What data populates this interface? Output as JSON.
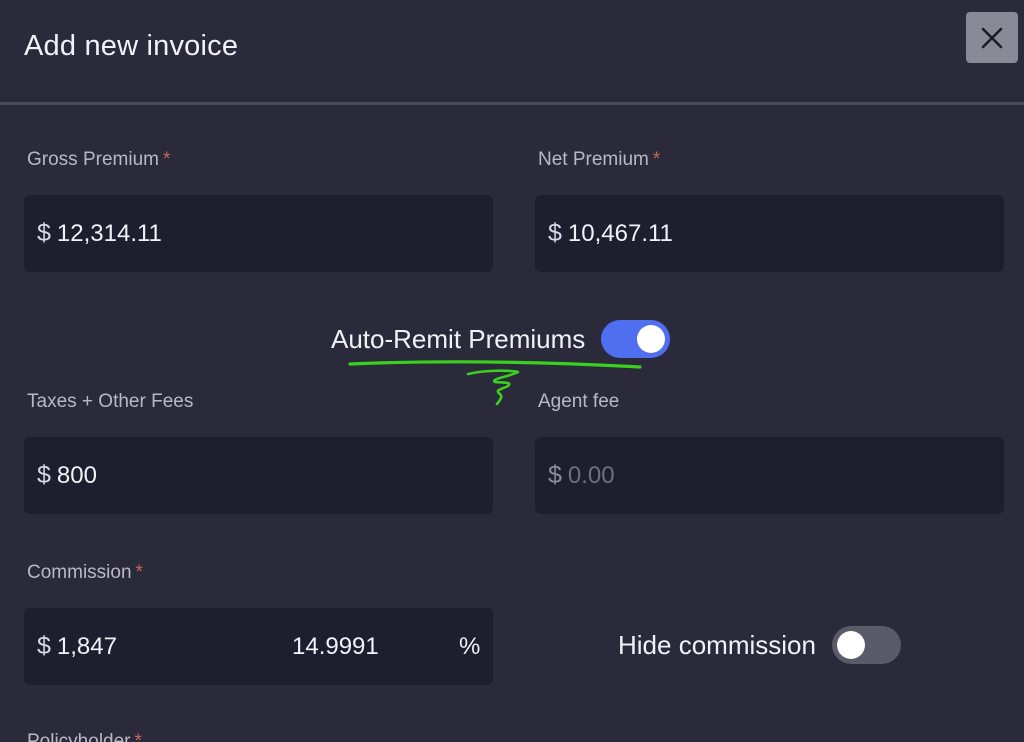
{
  "dialog": {
    "title": "Add new invoice",
    "close_icon": "close-icon"
  },
  "fields": {
    "gross_premium": {
      "label": "Gross Premium",
      "required": "*",
      "currency": "$",
      "value": "12,314.11"
    },
    "net_premium": {
      "label": "Net Premium",
      "required": "*",
      "currency": "$",
      "value": "10,467.11"
    },
    "taxes_fees": {
      "label": "Taxes + Other Fees",
      "currency": "$",
      "value": "800"
    },
    "agent_fee": {
      "label": "Agent fee",
      "currency": "$",
      "placeholder": "0.00"
    },
    "commission": {
      "label": "Commission",
      "required": "*",
      "currency": "$",
      "value": "1,847",
      "percent": "14.9991",
      "percent_sign": "%"
    },
    "policyholder": {
      "label": "Policyholder",
      "required": "*"
    }
  },
  "toggles": {
    "auto_remit": {
      "label": "Auto-Remit Premiums",
      "state": "on",
      "color": "#4f6ef0"
    },
    "hide_commission": {
      "label": "Hide commission",
      "state": "off"
    }
  },
  "annotation": {
    "color": "#39d11e"
  }
}
